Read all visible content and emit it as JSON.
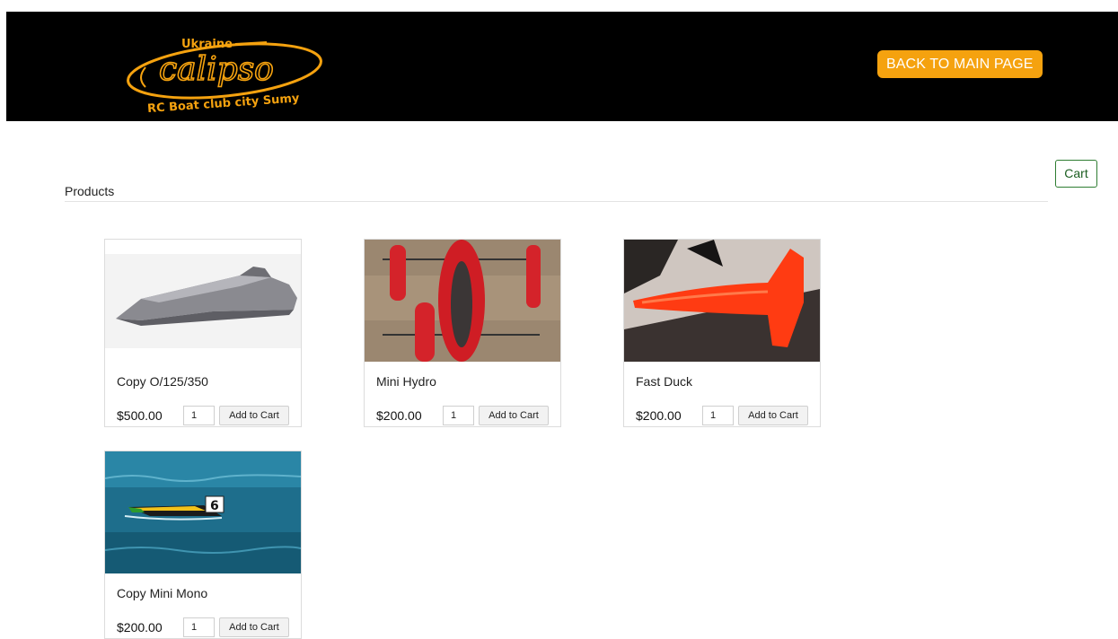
{
  "header": {
    "logo": {
      "top_text": "Ukraine",
      "brand_text": "calipso",
      "bottom_text": "RC Boat club city Sumy",
      "color": "#f5a20f"
    },
    "back_button_label": "BACK TO MAIN PAGE",
    "background": "#000000"
  },
  "cart_button_label": "Cart",
  "section_title": "Products",
  "products": [
    {
      "name": "Copy O/125/350",
      "price": "$500.00",
      "quantity": "1",
      "add_label": "Add to Cart",
      "image": "grey-hull-render"
    },
    {
      "name": "Mini Hydro",
      "price": "$200.00",
      "quantity": "1",
      "add_label": "Add to Cart",
      "image": "red-hydroplane-parts"
    },
    {
      "name": "Fast Duck",
      "price": "$200.00",
      "quantity": "1",
      "add_label": "Add to Cart",
      "image": "orange-boat-hull"
    },
    {
      "name": "Copy Mini Mono",
      "price": "$200.00",
      "quantity": "1",
      "add_label": "Add to Cart",
      "image": "boat-number-6-on-water"
    }
  ],
  "colors": {
    "accent": "#f5a20f",
    "cart_border": "#2e7d32"
  }
}
